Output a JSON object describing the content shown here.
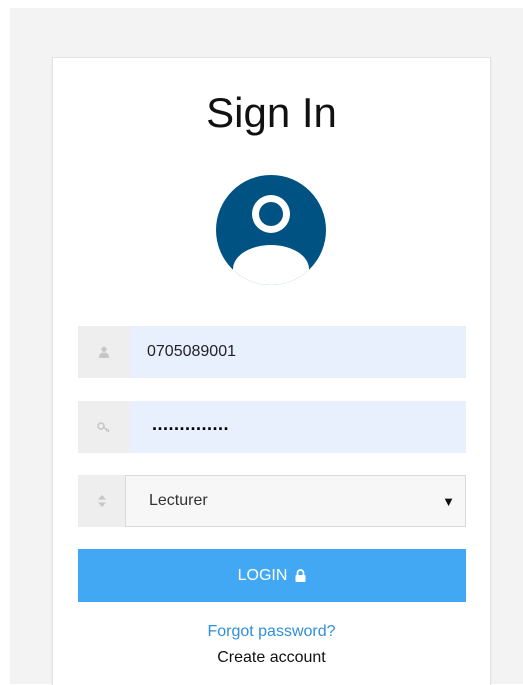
{
  "form": {
    "title": "Sign In",
    "username_value": "0705089001",
    "password_mask": "..............",
    "role_selected": "Lecturer",
    "login_label": "LOGIN",
    "forgot_label": "Forgot password?",
    "create_label": "Create account"
  },
  "icons": {
    "avatar": "user-avatar-icon",
    "username_addon": "user-icon",
    "password_addon": "key-icon",
    "role_addon": "sort-icon",
    "login": "lock-icon",
    "dropdown": "caret-down-icon"
  },
  "colors": {
    "avatar": "#005283",
    "login_button": "#43a8f4",
    "link": "#2f8fd8",
    "autofill": "#e8f0fe"
  }
}
